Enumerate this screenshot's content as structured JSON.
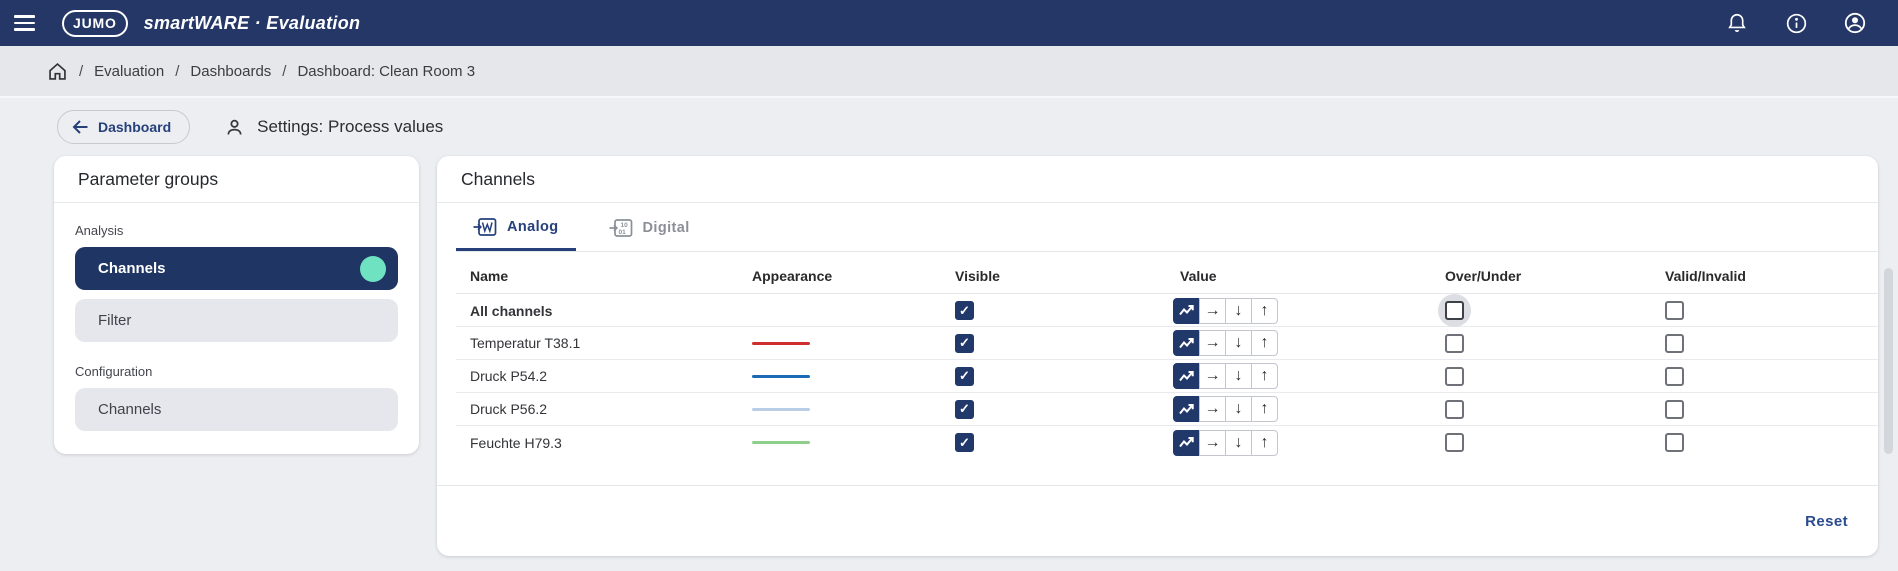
{
  "header": {
    "logo_text": "JUMO",
    "brand": "smartWARE · Evaluation"
  },
  "breadcrumb": {
    "separator": "/",
    "items": [
      "Evaluation",
      "Dashboards",
      "Dashboard: Clean Room 3"
    ]
  },
  "toolbar": {
    "back_label": "Dashboard",
    "title": "Settings: Process values"
  },
  "sidebar": {
    "title": "Parameter groups",
    "groups": [
      {
        "label": "Analysis",
        "items": [
          {
            "label": "Channels",
            "active": true,
            "badge": true
          },
          {
            "label": "Filter",
            "active": false
          }
        ]
      },
      {
        "label": "Configuration",
        "items": [
          {
            "label": "Channels",
            "active": false
          }
        ]
      }
    ]
  },
  "main": {
    "title": "Channels",
    "tabs": [
      {
        "label": "Analog",
        "active": true
      },
      {
        "label": "Digital",
        "active": false
      }
    ],
    "table": {
      "columns": [
        "Name",
        "Appearance",
        "Visible",
        "Value",
        "Over/Under",
        "Valid/Invalid"
      ],
      "rows": [
        {
          "name": "All channels",
          "bold": true,
          "line_color": null,
          "visible": true,
          "value_mode": "trend",
          "over_under": false,
          "valid_invalid": false,
          "focus_ring": true
        },
        {
          "name": "Temperatur T38.1",
          "bold": false,
          "line_color": "#cf2e2e",
          "visible": true,
          "value_mode": "trend",
          "over_under": false,
          "valid_invalid": false,
          "focus_ring": false
        },
        {
          "name": "Druck P54.2",
          "bold": false,
          "line_color": "#1a6ab5",
          "visible": true,
          "value_mode": "trend",
          "over_under": false,
          "valid_invalid": false,
          "focus_ring": false
        },
        {
          "name": "Druck P56.2",
          "bold": false,
          "line_color": "#b9cde6",
          "visible": true,
          "value_mode": "trend",
          "over_under": false,
          "valid_invalid": false,
          "focus_ring": false
        },
        {
          "name": "Feuchte H79.3",
          "bold": false,
          "line_color": "#8ed08b",
          "visible": true,
          "value_mode": "trend",
          "over_under": false,
          "valid_invalid": false,
          "focus_ring": false
        }
      ]
    },
    "reset_label": "Reset"
  },
  "icons": {
    "check": "✓",
    "value_arrows": [
      "→",
      "↓",
      "↑"
    ],
    "menu": "hamburger",
    "notifications": "bell-outline",
    "info": "info-circle",
    "account": "account-circle",
    "home": "home-outline",
    "settings_user": "person-outline",
    "back": "arrow-left",
    "analog_tab": "analog-signal-box",
    "digital_tab": "digital-bits-box",
    "value_trend": "zigzag-chart"
  },
  "colors": {
    "header_bg": "#243767",
    "primary_navy": "#21386b",
    "accent_teal": "#6fe2c1",
    "page_bg": "#edeef2",
    "breadcrumb_bg": "#e6e7eb",
    "card_bg": "#ffffff",
    "reset_text": "#2a4b8d"
  }
}
